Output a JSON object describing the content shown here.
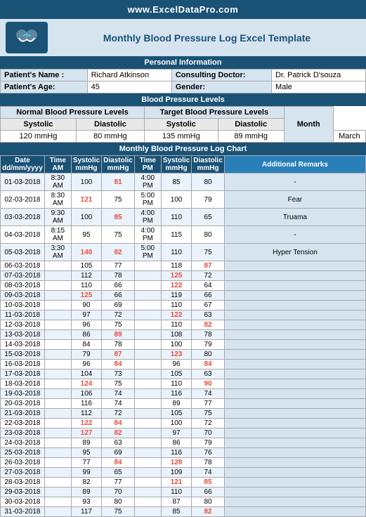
{
  "header": {
    "website": "www.ExcelDataPro.com",
    "title": "Monthly Blood Pressure Log Excel Template",
    "logo_icon": "handshake"
  },
  "personal_info": {
    "section_title": "Personal Information",
    "labels": {
      "patient_name": "Patient's Name :",
      "patient_age": "Patient's Age:",
      "consulting_doctor": "Consulting Doctor:",
      "gender": "Gender:"
    },
    "values": {
      "patient_name": "Richard Atkinson",
      "patient_age": "45",
      "consulting_doctor": "Dr. Patrick D'souza",
      "gender": "Male"
    }
  },
  "bp_levels": {
    "section_title": "Blood Pressure Levels",
    "normal_header": "Normal Blood Pressure Levels",
    "target_header": "Target Blood Pressure Levels",
    "normal_systolic_label": "Systolic",
    "normal_diastolic_label": "Diastolic",
    "target_systolic_label": "Systolic",
    "target_diastolic_label": "Diastolic",
    "normal_systolic_value": "120 mmHg",
    "normal_diastolic_value": "80 mmHg",
    "target_systolic_value": "135 mmHg",
    "target_diastolic_value": "89 mmHg",
    "month_label": "Month",
    "month_value": "March"
  },
  "chart": {
    "section_title": "Monthly Blood Pressure Log Chart",
    "columns": [
      "Date\ndd/mm/yyyy",
      "Time\nAM",
      "Systolic\nmmHg",
      "Diastolic\nmmHg",
      "Time\nPM",
      "Systolic\nmmHg",
      "Diastolic\nmmHg",
      "Additional Remarks"
    ],
    "rows": [
      {
        "date": "01-03-2018",
        "time_am": "8:30 AM",
        "sys_am": "100",
        "dia_am": "81",
        "time_pm": "4:00 PM",
        "sys_pm": "85",
        "dia_pm": "80",
        "remark": "-",
        "sys_am_high": false,
        "dia_am_high": true,
        "sys_pm_high": false,
        "dia_pm_high": false
      },
      {
        "date": "02-03-2018",
        "time_am": "8:30 AM",
        "sys_am": "121",
        "dia_am": "75",
        "time_pm": "5:00 PM",
        "sys_pm": "100",
        "dia_pm": "79",
        "remark": "Fear",
        "sys_am_high": true,
        "dia_am_high": false,
        "sys_pm_high": false,
        "dia_pm_high": false
      },
      {
        "date": "03-03-2018",
        "time_am": "9:30 AM",
        "sys_am": "100",
        "dia_am": "85",
        "time_pm": "4:00 PM",
        "sys_pm": "110",
        "dia_pm": "65",
        "remark": "Truama",
        "sys_am_high": false,
        "dia_am_high": true,
        "sys_pm_high": false,
        "dia_pm_high": false
      },
      {
        "date": "04-03-2018",
        "time_am": "8:15 AM",
        "sys_am": "95",
        "dia_am": "75",
        "time_pm": "4:00 PM",
        "sys_pm": "115",
        "dia_pm": "80",
        "remark": "-",
        "sys_am_high": false,
        "dia_am_high": false,
        "sys_pm_high": false,
        "dia_pm_high": false
      },
      {
        "date": "05-03-2018",
        "time_am": "3:30 AM",
        "sys_am": "140",
        "dia_am": "82",
        "time_pm": "5:00 PM",
        "sys_pm": "110",
        "dia_pm": "75",
        "remark": "Hyper Tension",
        "sys_am_high": true,
        "dia_am_high": true,
        "sys_pm_high": false,
        "dia_pm_high": false
      },
      {
        "date": "06-03-2018",
        "time_am": "",
        "sys_am": "105",
        "dia_am": "77",
        "time_pm": "",
        "sys_pm": "118",
        "dia_pm": "87",
        "remark": "",
        "sys_am_high": false,
        "dia_am_high": false,
        "sys_pm_high": false,
        "dia_pm_high": true
      },
      {
        "date": "07-03-2018",
        "time_am": "",
        "sys_am": "112",
        "dia_am": "78",
        "time_pm": "",
        "sys_pm": "125",
        "dia_pm": "72",
        "remark": "",
        "sys_am_high": false,
        "dia_am_high": false,
        "sys_pm_high": true,
        "dia_pm_high": false
      },
      {
        "date": "08-03-2018",
        "time_am": "",
        "sys_am": "110",
        "dia_am": "66",
        "time_pm": "",
        "sys_pm": "122",
        "dia_pm": "64",
        "remark": "",
        "sys_am_high": false,
        "dia_am_high": false,
        "sys_pm_high": true,
        "dia_pm_high": false
      },
      {
        "date": "09-03-2018",
        "time_am": "",
        "sys_am": "125",
        "dia_am": "66",
        "time_pm": "",
        "sys_pm": "119",
        "dia_pm": "66",
        "remark": "",
        "sys_am_high": true,
        "dia_am_high": false,
        "sys_pm_high": false,
        "dia_pm_high": false
      },
      {
        "date": "10-03-2018",
        "time_am": "",
        "sys_am": "90",
        "dia_am": "69",
        "time_pm": "",
        "sys_pm": "110",
        "dia_pm": "67",
        "remark": "",
        "sys_am_high": false,
        "dia_am_high": false,
        "sys_pm_high": false,
        "dia_pm_high": false
      },
      {
        "date": "11-03-2018",
        "time_am": "",
        "sys_am": "97",
        "dia_am": "72",
        "time_pm": "",
        "sys_pm": "122",
        "dia_pm": "63",
        "remark": "",
        "sys_am_high": false,
        "dia_am_high": false,
        "sys_pm_high": true,
        "dia_pm_high": false
      },
      {
        "date": "12-03-2018",
        "time_am": "",
        "sys_am": "96",
        "dia_am": "75",
        "time_pm": "",
        "sys_pm": "110",
        "dia_pm": "82",
        "remark": "",
        "sys_am_high": false,
        "dia_am_high": false,
        "sys_pm_high": false,
        "dia_pm_high": true
      },
      {
        "date": "13-03-2018",
        "time_am": "",
        "sys_am": "86",
        "dia_am": "89",
        "time_pm": "",
        "sys_pm": "108",
        "dia_pm": "78",
        "remark": "",
        "sys_am_high": false,
        "dia_am_high": true,
        "sys_pm_high": false,
        "dia_pm_high": false
      },
      {
        "date": "14-03-2018",
        "time_am": "",
        "sys_am": "84",
        "dia_am": "78",
        "time_pm": "",
        "sys_pm": "100",
        "dia_pm": "79",
        "remark": "",
        "sys_am_high": false,
        "dia_am_high": false,
        "sys_pm_high": false,
        "dia_pm_high": false
      },
      {
        "date": "15-03-2018",
        "time_am": "",
        "sys_am": "79",
        "dia_am": "87",
        "time_pm": "",
        "sys_pm": "123",
        "dia_pm": "80",
        "remark": "",
        "sys_am_high": false,
        "dia_am_high": true,
        "sys_pm_high": true,
        "dia_pm_high": false
      },
      {
        "date": "16-03-2018",
        "time_am": "",
        "sys_am": "96",
        "dia_am": "84",
        "time_pm": "",
        "sys_pm": "96",
        "dia_pm": "84",
        "remark": "",
        "sys_am_high": false,
        "dia_am_high": true,
        "sys_pm_high": false,
        "dia_pm_high": true
      },
      {
        "date": "17-03-2018",
        "time_am": "",
        "sys_am": "104",
        "dia_am": "73",
        "time_pm": "",
        "sys_pm": "105",
        "dia_pm": "63",
        "remark": "",
        "sys_am_high": false,
        "dia_am_high": false,
        "sys_pm_high": false,
        "dia_pm_high": false
      },
      {
        "date": "18-03-2018",
        "time_am": "",
        "sys_am": "124",
        "dia_am": "75",
        "time_pm": "",
        "sys_pm": "110",
        "dia_pm": "90",
        "remark": "",
        "sys_am_high": true,
        "dia_am_high": false,
        "sys_pm_high": false,
        "dia_pm_high": true
      },
      {
        "date": "19-03-2018",
        "time_am": "",
        "sys_am": "106",
        "dia_am": "74",
        "time_pm": "",
        "sys_pm": "116",
        "dia_pm": "74",
        "remark": "",
        "sys_am_high": false,
        "dia_am_high": false,
        "sys_pm_high": false,
        "dia_pm_high": false
      },
      {
        "date": "20-03-2018",
        "time_am": "",
        "sys_am": "116",
        "dia_am": "74",
        "time_pm": "",
        "sys_pm": "89",
        "dia_pm": "77",
        "remark": "",
        "sys_am_high": false,
        "dia_am_high": false,
        "sys_pm_high": false,
        "dia_pm_high": false
      },
      {
        "date": "21-03-2018",
        "time_am": "",
        "sys_am": "112",
        "dia_am": "72",
        "time_pm": "",
        "sys_pm": "105",
        "dia_pm": "75",
        "remark": "",
        "sys_am_high": false,
        "dia_am_high": false,
        "sys_pm_high": false,
        "dia_pm_high": false
      },
      {
        "date": "22-03-2018",
        "time_am": "",
        "sys_am": "122",
        "dia_am": "84",
        "time_pm": "",
        "sys_pm": "100",
        "dia_pm": "72",
        "remark": "",
        "sys_am_high": true,
        "dia_am_high": true,
        "sys_pm_high": false,
        "dia_pm_high": false
      },
      {
        "date": "23-03-2018",
        "time_am": "",
        "sys_am": "127",
        "dia_am": "82",
        "time_pm": "",
        "sys_pm": "97",
        "dia_pm": "70",
        "remark": "",
        "sys_am_high": true,
        "dia_am_high": true,
        "sys_pm_high": false,
        "dia_pm_high": false
      },
      {
        "date": "24-03-2018",
        "time_am": "",
        "sys_am": "89",
        "dia_am": "63",
        "time_pm": "",
        "sys_pm": "86",
        "dia_pm": "79",
        "remark": "",
        "sys_am_high": false,
        "dia_am_high": false,
        "sys_pm_high": false,
        "dia_pm_high": false
      },
      {
        "date": "25-03-2018",
        "time_am": "",
        "sys_am": "95",
        "dia_am": "69",
        "time_pm": "",
        "sys_pm": "116",
        "dia_pm": "76",
        "remark": "",
        "sys_am_high": false,
        "dia_am_high": false,
        "sys_pm_high": false,
        "dia_pm_high": false
      },
      {
        "date": "26-03-2018",
        "time_am": "",
        "sys_am": "77",
        "dia_am": "84",
        "time_pm": "",
        "sys_pm": "128",
        "dia_pm": "78",
        "remark": "",
        "sys_am_high": false,
        "dia_am_high": true,
        "sys_pm_high": true,
        "dia_pm_high": false
      },
      {
        "date": "27-03-2018",
        "time_am": "",
        "sys_am": "99",
        "dia_am": "65",
        "time_pm": "",
        "sys_pm": "109",
        "dia_pm": "74",
        "remark": "",
        "sys_am_high": false,
        "dia_am_high": false,
        "sys_pm_high": false,
        "dia_pm_high": false
      },
      {
        "date": "28-03-2018",
        "time_am": "",
        "sys_am": "82",
        "dia_am": "77",
        "time_pm": "",
        "sys_pm": "121",
        "dia_pm": "85",
        "remark": "",
        "sys_am_high": false,
        "dia_am_high": false,
        "sys_pm_high": true,
        "dia_pm_high": true
      },
      {
        "date": "29-03-2018",
        "time_am": "",
        "sys_am": "89",
        "dia_am": "70",
        "time_pm": "",
        "sys_pm": "110",
        "dia_pm": "66",
        "remark": "",
        "sys_am_high": false,
        "dia_am_high": false,
        "sys_pm_high": false,
        "dia_pm_high": false
      },
      {
        "date": "30-03-2018",
        "time_am": "",
        "sys_am": "93",
        "dia_am": "80",
        "time_pm": "",
        "sys_pm": "87",
        "dia_pm": "80",
        "remark": "",
        "sys_am_high": false,
        "dia_am_high": false,
        "sys_pm_high": false,
        "dia_pm_high": false
      },
      {
        "date": "31-03-2018",
        "time_am": "",
        "sys_am": "117",
        "dia_am": "75",
        "time_pm": "",
        "sys_pm": "85",
        "dia_pm": "82",
        "remark": "",
        "sys_am_high": false,
        "dia_am_high": false,
        "sys_pm_high": false,
        "dia_pm_high": true
      }
    ]
  }
}
